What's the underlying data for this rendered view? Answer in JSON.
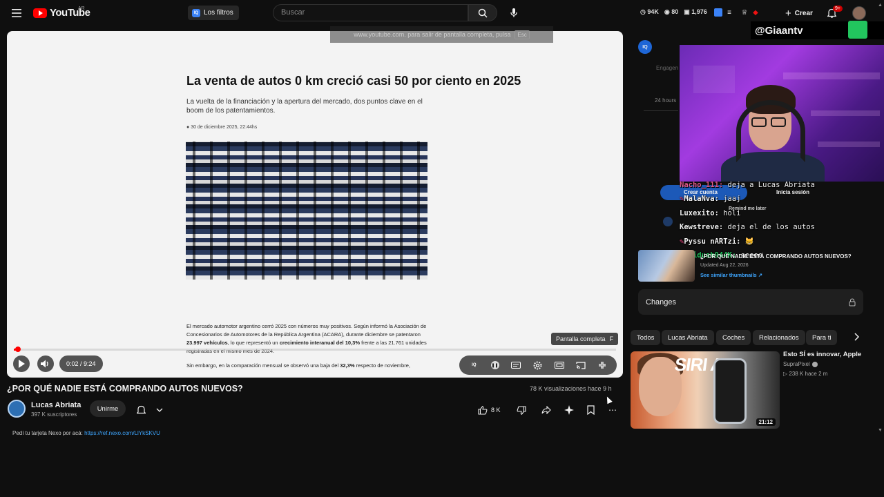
{
  "topbar": {
    "logo_text": "YouTube",
    "country_code": "AR",
    "filters_badge": "IQ",
    "filters_label": "Los filtros",
    "search_placeholder": "Buscar",
    "stats": [
      "94K",
      "80",
      "1,976"
    ],
    "create_label": "Crear",
    "notif_count": "9+"
  },
  "video": {
    "fullscreen_message": "www.youtube.com. para salir de pantalla completa, pulsa",
    "esc_key": "Esc",
    "article_title": "La venta de autos 0 km creció casi 50 por ciento en 2025",
    "article_subtitle": "La vuelta de la financiación y la apertura del mercado, dos puntos clave en el boom de los patentamientos.",
    "article_date": "30 de diciembre 2025, 22:44hs",
    "article_body": {
      "p1_a": "El mercado automotor argentino cerró 2025 con números muy positivos. Según informó la Asociación de Concesionarios de Automotores de la República Argentina (ACARA), durante diciembre se patentaron ",
      "p1_b": "23.997 vehículos",
      "p1_c": ", lo que representó un ",
      "p1_d": "crecimiento interanual del 10,3%",
      "p1_e": " frente a las 21.761 unidades registradas en el mismo mes de 2024.",
      "p2_a": "Sin embargo, en la comparación mensual se observó una baja del ",
      "p2_b": "32,3%",
      "p2_c": " respecto de noviembre,"
    },
    "fullscreen_tooltip": "Pantalla completa",
    "fullscreen_key": "F",
    "time": "0:02 / 9:24",
    "progress_fraction": 0.004,
    "ext_badge": "IQ"
  },
  "meta": {
    "title": "¿POR QUÉ NADIE ESTÁ COMPRANDO AUTOS NUEVOS?",
    "views": "78 K visualizaciones  hace 9 h",
    "channel_name": "Lucas Abriata",
    "subscribers": "397 K suscriptores",
    "join_label": "Unirme",
    "likes": "8 K",
    "description_prefix": "Pedí tu tarjeta Nexo por acá: ",
    "description_link": "https://ref.nexo.com/LlYkSKVU"
  },
  "panel": {
    "iq_badge": "IQ",
    "engagement_label": "Engagen",
    "hours_label": "24 hours",
    "streamer_handle": "@Giaantv",
    "create_account": "Crear cuenta",
    "sign_in": "Inicia sesión",
    "remind_later": "Remind me later",
    "chat": [
      {
        "user": "Nacho_111:",
        "msg": "deja a Lucas Abriata",
        "color": "#e05a8a",
        "badge": false
      },
      {
        "user": "MalaNva:",
        "msg": "jaaj",
        "color": "#f0f0f0",
        "badge": true
      },
      {
        "user": "Luxexito:",
        "msg": "holi",
        "color": "#f0f0f0",
        "badge": false
      },
      {
        "user": "Kewstreve:",
        "msg": "deja el de los autos",
        "color": "#f0f0f0",
        "badge": false
      },
      {
        "user": "Pyssu nARTzi:",
        "msg": "😸",
        "color": "#f0f0f0",
        "badge": true
      },
      {
        "user": "Sloidush944K:",
        "msg": "seeee",
        "color": "#22c55e",
        "badge": false
      }
    ],
    "related": {
      "title": "¿POR QUÉ NADIE ESTÁ COMPRANDO AUTOS NUEVOS?",
      "updated": "Updated Aug 22, 2026",
      "link": "See similar thumbnails ↗"
    },
    "changes_label": "Changes",
    "chips": [
      "Todos",
      "Lucas Abriata",
      "Coches",
      "Relacionados",
      "Para ti"
    ],
    "recommendation": {
      "thumb_text": "SIRI AI",
      "title": "Esto SÍ es innovar, Apple",
      "channel": "SupraPixel",
      "meta": "▷ 238 K   hace 2 m",
      "duration": "21:12"
    }
  }
}
